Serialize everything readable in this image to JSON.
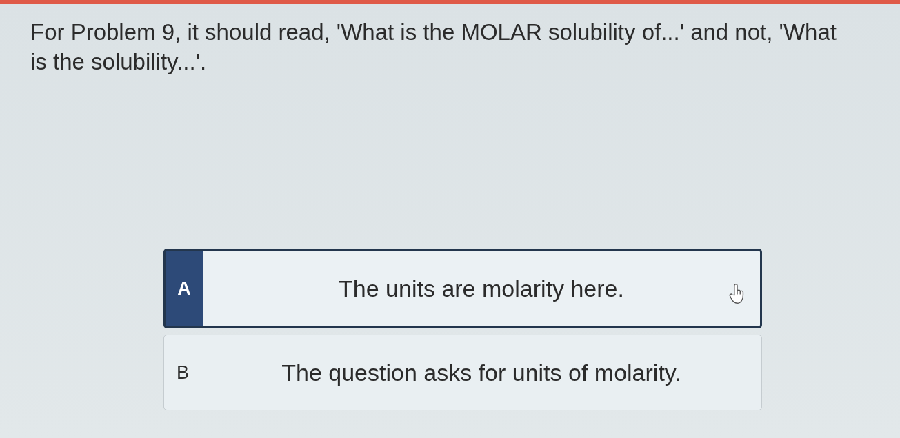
{
  "note": {
    "text": "For Problem 9, it should read, 'What is the MOLAR solubility of...' and not, 'What is the solubility...'."
  },
  "options": [
    {
      "letter": "A",
      "text": "The units are molarity here.",
      "selected": true
    },
    {
      "letter": "B",
      "text": "The question asks for units of molarity.",
      "selected": false
    }
  ]
}
